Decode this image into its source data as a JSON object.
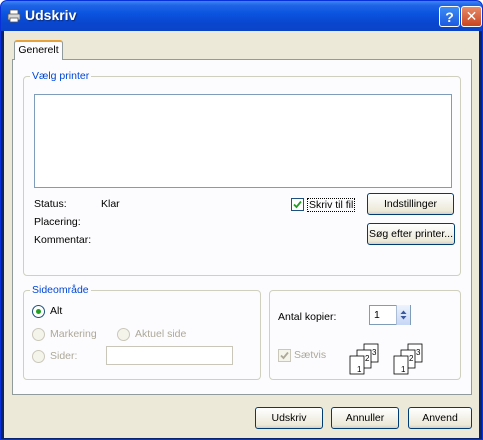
{
  "window": {
    "title": "Udskriv",
    "help_label": "?",
    "close_label": "✕"
  },
  "tabs": [
    {
      "label": "Generelt",
      "active": true
    }
  ],
  "printer_group": {
    "title": "Vælg printer",
    "status_label": "Status:",
    "status_value": "Klar",
    "location_label": "Placering:",
    "comment_label": "Kommentar:",
    "print_to_file_label": "Skriv til fil",
    "print_to_file_checked": true,
    "settings_button": "Indstillinger",
    "find_printer_button": "Søg efter printer..."
  },
  "range_group": {
    "title": "Sideområde",
    "all_label": "Alt",
    "all_selected": true,
    "selection_label": "Markering",
    "current_page_label": "Aktuel side",
    "pages_label": "Sider:",
    "pages_value": ""
  },
  "copies_group": {
    "copies_label": "Antal kopier:",
    "copies_value": "1",
    "collate_label": "Sætvis",
    "collate_checked": true,
    "collate_icon": "collate-pages-icon",
    "uncollate_icon": "uncollated-pages-icon"
  },
  "footer": {
    "print_button": "Udskriv",
    "cancel_button": "Annuller",
    "apply_button": "Anvend"
  },
  "colors": {
    "titlebar": "#0a55e0",
    "dialog_bg": "#ece9d8",
    "group_label": "#0046d5",
    "check_green": "#21a121"
  }
}
